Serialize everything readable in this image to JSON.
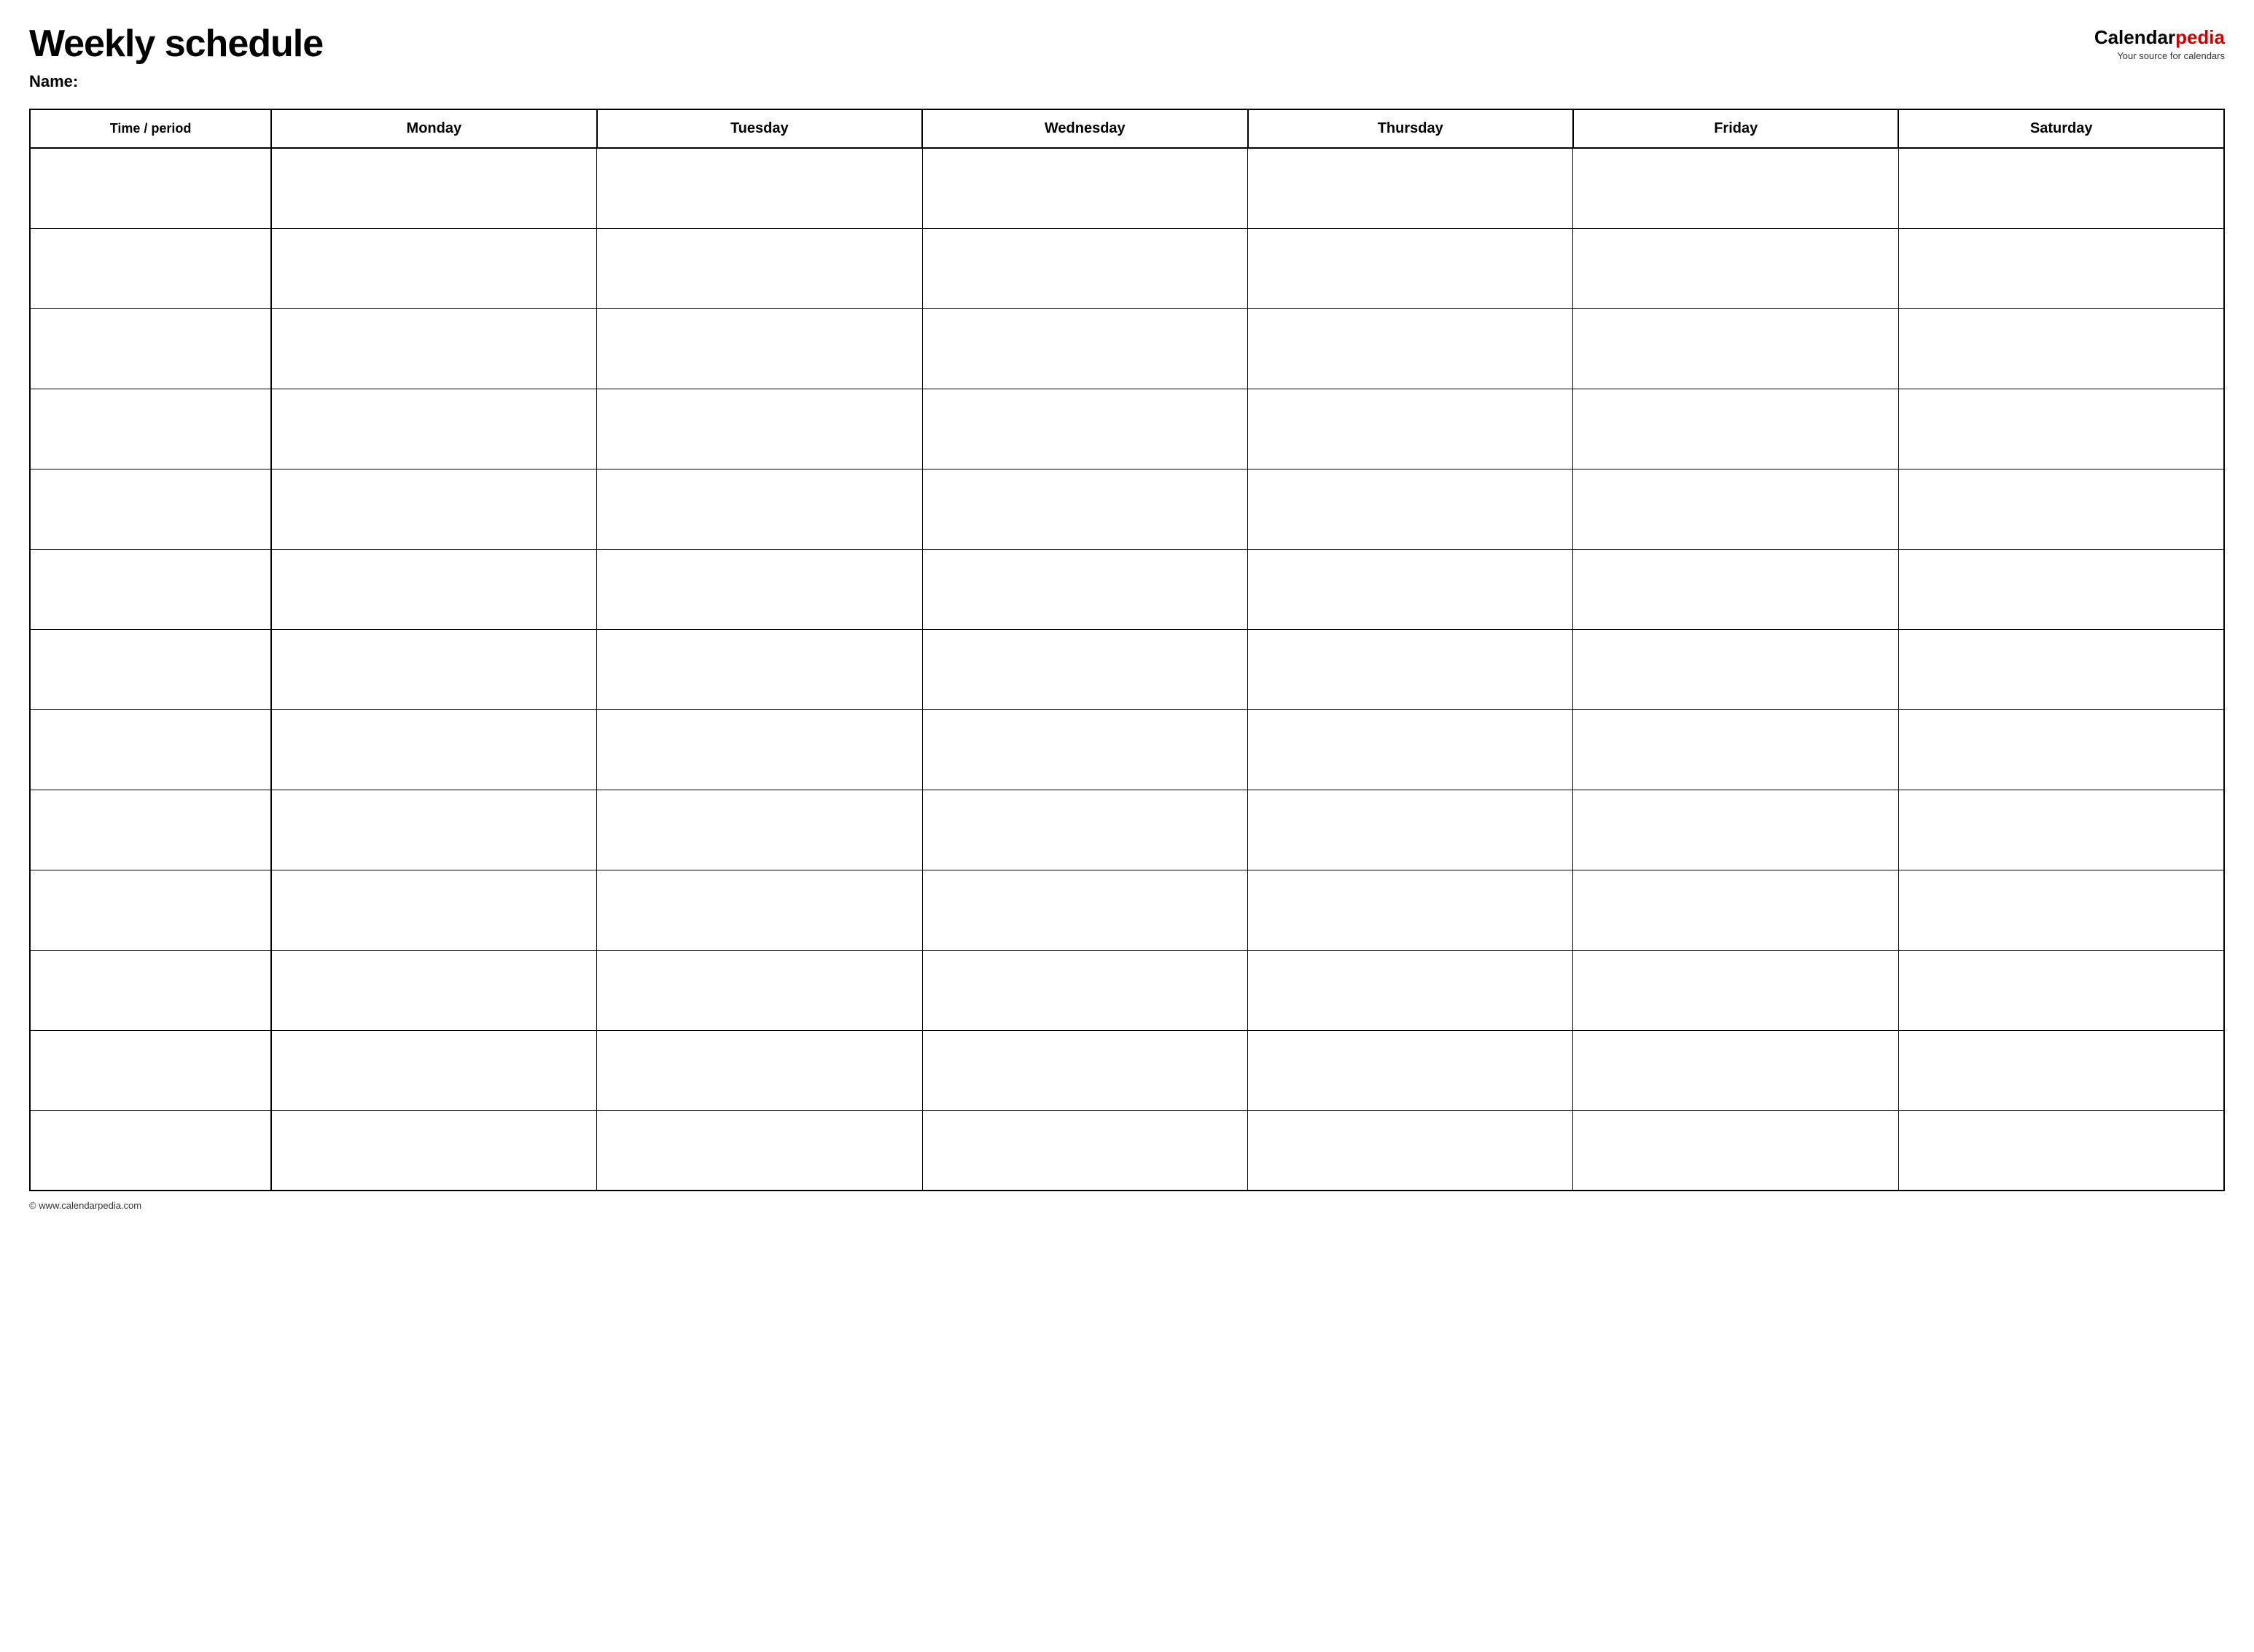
{
  "header": {
    "title": "Weekly schedule",
    "name_label": "Name:",
    "logo": {
      "text_black": "Calendar",
      "text_red": "pedia",
      "tagline": "Your source for calendars"
    }
  },
  "table": {
    "columns": [
      {
        "label": "Time / period",
        "type": "time"
      },
      {
        "label": "Monday",
        "type": "day"
      },
      {
        "label": "Tuesday",
        "type": "day"
      },
      {
        "label": "Wednesday",
        "type": "day"
      },
      {
        "label": "Thursday",
        "type": "day"
      },
      {
        "label": "Friday",
        "type": "day"
      },
      {
        "label": "Saturday",
        "type": "day"
      }
    ],
    "row_count": 13
  },
  "footer": {
    "url": "© www.calendarpedia.com"
  }
}
